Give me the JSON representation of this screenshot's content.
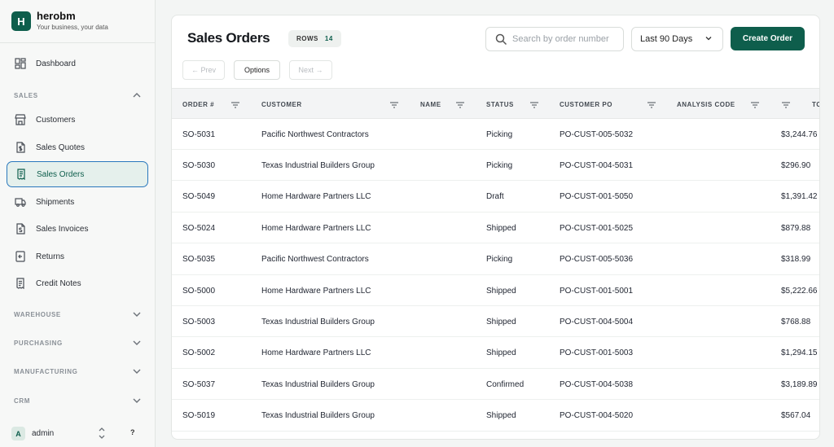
{
  "brand": {
    "initial": "H",
    "name": "herobm",
    "tagline": "Your business, your data"
  },
  "nav": {
    "dashboard": "Dashboard",
    "sales_section": "SALES",
    "sales_items": [
      "Customers",
      "Sales Quotes",
      "Sales Orders",
      "Shipments",
      "Sales Invoices",
      "Returns",
      "Credit Notes"
    ],
    "sections": [
      "WAREHOUSE",
      "PURCHASING",
      "MANUFACTURING",
      "CRM"
    ]
  },
  "user": {
    "initial": "A",
    "name": "admin",
    "help": "?"
  },
  "page": {
    "title": "Sales Orders",
    "rows_label": "ROWS",
    "rows_count": "14",
    "search_placeholder": "Search by order number",
    "period": "Last 90 Days",
    "create_label": "Create Order",
    "prev_label": "← Prev",
    "options_label": "Options",
    "next_label": "Next →"
  },
  "table": {
    "columns": [
      "ORDER #",
      "CUSTOMER",
      "NAME",
      "STATUS",
      "CUSTOMER PO",
      "ANALYSIS CODE",
      "TOTAL"
    ],
    "rows": [
      [
        "SO-5031",
        "Pacific Northwest Contractors",
        "",
        "Picking",
        "PO-CUST-005-5032",
        "",
        "$3,244.76"
      ],
      [
        "SO-5030",
        "Texas Industrial Builders Group",
        "",
        "Picking",
        "PO-CUST-004-5031",
        "",
        "$296.90"
      ],
      [
        "SO-5049",
        "Home Hardware Partners LLC",
        "",
        "Draft",
        "PO-CUST-001-5050",
        "",
        "$1,391.42"
      ],
      [
        "SO-5024",
        "Home Hardware Partners LLC",
        "",
        "Shipped",
        "PO-CUST-001-5025",
        "",
        "$879.88"
      ],
      [
        "SO-5035",
        "Pacific Northwest Contractors",
        "",
        "Picking",
        "PO-CUST-005-5036",
        "",
        "$318.99"
      ],
      [
        "SO-5000",
        "Home Hardware Partners LLC",
        "",
        "Shipped",
        "PO-CUST-001-5001",
        "",
        "$5,222.66"
      ],
      [
        "SO-5003",
        "Texas Industrial Builders Group",
        "",
        "Shipped",
        "PO-CUST-004-5004",
        "",
        "$768.88"
      ],
      [
        "SO-5002",
        "Home Hardware Partners LLC",
        "",
        "Shipped",
        "PO-CUST-001-5003",
        "",
        "$1,294.15"
      ],
      [
        "SO-5037",
        "Texas Industrial Builders Group",
        "",
        "Confirmed",
        "PO-CUST-004-5038",
        "",
        "$3,189.89"
      ],
      [
        "SO-5019",
        "Texas Industrial Builders Group",
        "",
        "Shipped",
        "PO-CUST-004-5020",
        "",
        "$567.04"
      ]
    ]
  },
  "colors": {
    "brand": "#0e5e4c",
    "active_border": "#2a78bd"
  }
}
